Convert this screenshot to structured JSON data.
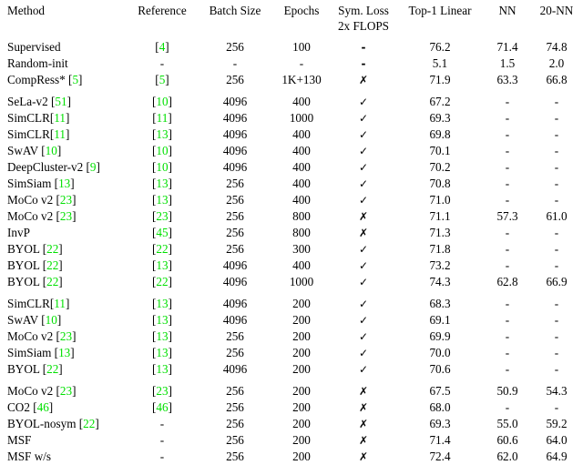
{
  "table": {
    "caption_visible": false,
    "accent_citation_color": "#00e000",
    "columns": [
      {
        "key": "method",
        "label": "Method",
        "align": "left"
      },
      {
        "key": "ref",
        "label": "Reference",
        "align": "center"
      },
      {
        "key": "batch",
        "label": "Batch Size",
        "align": "center"
      },
      {
        "key": "epochs",
        "label": "Epochs",
        "align": "center"
      },
      {
        "key": "sym",
        "label": "Sym. Loss",
        "label_line2": "2x FLOPS",
        "align": "center"
      },
      {
        "key": "top1",
        "label": "Top-1 Linear",
        "align": "center"
      },
      {
        "key": "nn",
        "label": "NN",
        "align": "center"
      },
      {
        "key": "nn20",
        "label": "20-NN",
        "align": "center"
      }
    ],
    "sections": [
      {
        "id": "baselines",
        "rows": [
          {
            "method": "Supervised",
            "method_cite": "",
            "ref": "[4]",
            "ref_cite": "4",
            "batch": "256",
            "epochs": "100",
            "sym": "-",
            "top1": "76.2",
            "nn": "71.4",
            "nn20": "74.8",
            "bold": []
          },
          {
            "method": "Random-init",
            "method_cite": "",
            "ref": "-",
            "ref_cite": "",
            "batch": "-",
            "epochs": "-",
            "sym": "-",
            "top1": "5.1",
            "nn": "1.5",
            "nn20": "2.0",
            "bold": []
          },
          {
            "method": "CompRess* [5]",
            "method_cite": "5",
            "ref": "[5]",
            "ref_cite": "5",
            "batch": "256",
            "epochs": "1K+130",
            "sym": "✗",
            "top1": "71.9",
            "nn": "63.3",
            "nn20": "66.8",
            "bold": []
          }
        ]
      },
      {
        "id": "long-training",
        "rows": [
          {
            "method": "SeLa-v2 [51]",
            "method_cite": "51",
            "ref": "[10]",
            "ref_cite": "10",
            "batch": "4096",
            "epochs": "400",
            "sym": "✓",
            "top1": "67.2",
            "nn": "-",
            "nn20": "-",
            "bold": []
          },
          {
            "method": "SimCLR[11]",
            "method_cite": "11",
            "ref": "[11]",
            "ref_cite": "11",
            "batch": "4096",
            "epochs": "1000",
            "sym": "✓",
            "top1": "69.3",
            "nn": "-",
            "nn20": "-",
            "bold": []
          },
          {
            "method": "SimCLR[11]",
            "method_cite": "11",
            "ref": "[13]",
            "ref_cite": "13",
            "batch": "4096",
            "epochs": "400",
            "sym": "✓",
            "top1": "69.8",
            "nn": "-",
            "nn20": "-",
            "bold": []
          },
          {
            "method": "SwAV [10]",
            "method_cite": "10",
            "ref": "[10]",
            "ref_cite": "10",
            "batch": "4096",
            "epochs": "400",
            "sym": "✓",
            "top1": "70.1",
            "nn": "-",
            "nn20": "-",
            "bold": []
          },
          {
            "method": "DeepCluster-v2 [9]",
            "method_cite": "9",
            "ref": "[10]",
            "ref_cite": "10",
            "batch": "4096",
            "epochs": "400",
            "sym": "✓",
            "top1": "70.2",
            "nn": "-",
            "nn20": "-",
            "bold": []
          },
          {
            "method": "SimSiam [13]",
            "method_cite": "13",
            "ref": "[13]",
            "ref_cite": "13",
            "batch": "256",
            "epochs": "400",
            "sym": "✓",
            "top1": "70.8",
            "nn": "-",
            "nn20": "-",
            "bold": []
          },
          {
            "method": "MoCo v2 [23]",
            "method_cite": "23",
            "ref": "[13]",
            "ref_cite": "13",
            "batch": "256",
            "epochs": "400",
            "sym": "✓",
            "top1": "71.0",
            "nn": "-",
            "nn20": "-",
            "bold": []
          },
          {
            "method": "MoCo v2 [23]",
            "method_cite": "23",
            "ref": "[23]",
            "ref_cite": "23",
            "batch": "256",
            "epochs": "800",
            "sym": "✗",
            "top1": "71.1",
            "nn": "57.3",
            "nn20": "61.0",
            "bold": []
          },
          {
            "method": "InvP",
            "method_cite": "",
            "ref": "[45]",
            "ref_cite": "45",
            "batch": "256",
            "epochs": "800",
            "sym": "✗",
            "top1": "71.3",
            "nn": "-",
            "nn20": "-",
            "bold": []
          },
          {
            "method": "BYOL [22]",
            "method_cite": "22",
            "ref": "[22]",
            "ref_cite": "22",
            "batch": "256",
            "epochs": "300",
            "sym": "✓",
            "top1": "71.8",
            "nn": "-",
            "nn20": "-",
            "bold": []
          },
          {
            "method": "BYOL [22]",
            "method_cite": "22",
            "ref": "[13]",
            "ref_cite": "13",
            "batch": "4096",
            "epochs": "400",
            "sym": "✓",
            "top1": "73.2",
            "nn": "-",
            "nn20": "-",
            "bold": [
              "top1"
            ]
          },
          {
            "method": "BYOL [22]",
            "method_cite": "22",
            "ref": "[22]",
            "ref_cite": "22",
            "batch": "4096",
            "epochs": "1000",
            "sym": "✓",
            "top1": "74.3",
            "nn": "62.8",
            "nn20": "66.9",
            "bold": [
              "top1"
            ]
          }
        ]
      },
      {
        "id": "epochs-200-sym",
        "rows": [
          {
            "method": "SimCLR[11]",
            "method_cite": "11",
            "ref": "[13]",
            "ref_cite": "13",
            "batch": "4096",
            "epochs": "200",
            "sym": "✓",
            "top1": "68.3",
            "nn": "-",
            "nn20": "-",
            "bold": []
          },
          {
            "method": "SwAV [10]",
            "method_cite": "10",
            "ref": "[13]",
            "ref_cite": "13",
            "batch": "4096",
            "epochs": "200",
            "sym": "✓",
            "top1": "69.1",
            "nn": "-",
            "nn20": "-",
            "bold": []
          },
          {
            "method": "MoCo v2 [23]",
            "method_cite": "23",
            "ref": "[13]",
            "ref_cite": "13",
            "batch": "256",
            "epochs": "200",
            "sym": "✓",
            "top1": "69.9",
            "nn": "-",
            "nn20": "-",
            "bold": []
          },
          {
            "method": "SimSiam [13]",
            "method_cite": "13",
            "ref": "[13]",
            "ref_cite": "13",
            "batch": "256",
            "epochs": "200",
            "sym": "✓",
            "top1": "70.0",
            "nn": "-",
            "nn20": "-",
            "bold": []
          },
          {
            "method": "BYOL [22]",
            "method_cite": "22",
            "ref": "[13]",
            "ref_cite": "13",
            "batch": "4096",
            "epochs": "200",
            "sym": "✓",
            "top1": "70.6",
            "nn": "-",
            "nn20": "-",
            "bold": [
              "top1"
            ]
          }
        ]
      },
      {
        "id": "epochs-200-nosym",
        "rows": [
          {
            "method": "MoCo v2 [23]",
            "method_cite": "23",
            "ref": "[23]",
            "ref_cite": "23",
            "batch": "256",
            "epochs": "200",
            "sym": "✗",
            "top1": "67.5",
            "nn": "50.9",
            "nn20": "54.3",
            "bold": []
          },
          {
            "method": "CO2 [46]",
            "method_cite": "46",
            "ref": "[46]",
            "ref_cite": "46",
            "batch": "256",
            "epochs": "200",
            "sym": "✗",
            "top1": "68.0",
            "nn": "-",
            "nn20": "-",
            "bold": []
          },
          {
            "method": "BYOL-nosym [22]",
            "method_cite": "22",
            "ref": "-",
            "ref_cite": "",
            "batch": "256",
            "epochs": "200",
            "sym": "✗",
            "top1": "69.3",
            "nn": "55.0",
            "nn20": "59.2",
            "bold": []
          },
          {
            "method": "MSF",
            "method_cite": "",
            "ref": "-",
            "ref_cite": "",
            "batch": "256",
            "epochs": "200",
            "sym": "✗",
            "top1": "71.4",
            "nn": "60.6",
            "nn20": "64.0",
            "bold": []
          },
          {
            "method": "MSF w/s",
            "method_cite": "",
            "ref": "-",
            "ref_cite": "",
            "batch": "256",
            "epochs": "200",
            "sym": "✗",
            "top1": "72.4",
            "nn": "62.0",
            "nn20": "64.9",
            "bold": [
              "top1",
              "nn",
              "nn20"
            ]
          }
        ]
      }
    ]
  }
}
